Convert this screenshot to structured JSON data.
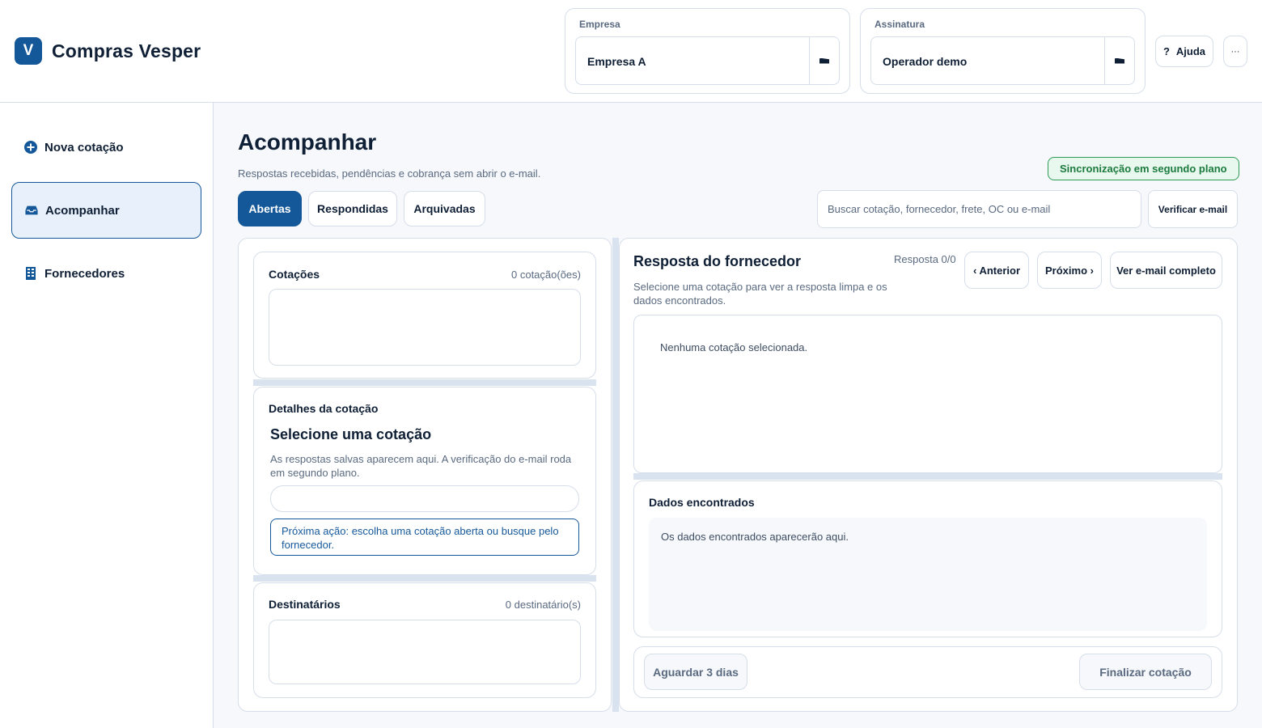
{
  "app": {
    "logo_letter": "V",
    "name": "Compras Vesper",
    "brand_color": "#15589a"
  },
  "header": {
    "company": {
      "label": "Empresa",
      "value": "Empresa A"
    },
    "subscription": {
      "label": "Assinatura",
      "value": "Operador demo"
    },
    "help_icon": "?",
    "help_label": "Ajuda",
    "more_label": "···"
  },
  "sidebar": {
    "items": [
      {
        "label": "Nova cotação",
        "icon": "plus-circle-icon",
        "active": false
      },
      {
        "label": "Acompanhar",
        "icon": "inbox-icon",
        "active": true
      },
      {
        "label": "Fornecedores",
        "icon": "building-icon",
        "active": false
      }
    ]
  },
  "main": {
    "title": "Acompanhar",
    "subtitle": "Respostas recebidas, pendências e cobrança sem abrir o e-mail.",
    "sync_badge": "Sincronização em segundo plano",
    "tabs": [
      {
        "label": "Abertas",
        "active": true
      },
      {
        "label": "Respondidas",
        "active": false
      },
      {
        "label": "Arquivadas",
        "active": false
      }
    ],
    "search_placeholder": "Buscar cotação, fornecedor, frete, OC ou e-mail",
    "verify_label": "Verificar e-mail"
  },
  "quotes": {
    "title": "Cotações",
    "count": "0 cotação(ões)"
  },
  "details": {
    "title": "Detalhes da cotação",
    "heading": "Selecione uma cotação",
    "text": "As respostas salvas aparecem aqui. A verificação do e-mail roda em segundo plano.",
    "next_action": "Próxima ação: escolha uma cotação aberta ou busque pelo fornecedor."
  },
  "recipients": {
    "title": "Destinatários",
    "count": "0 destinatário(s)"
  },
  "response": {
    "title": "Resposta do fornecedor",
    "subtitle": "Selecione uma cotação para ver a resposta limpa e os dados encontrados.",
    "counter": "Resposta 0/0",
    "prev_label": "‹ Anterior",
    "next_label": "Próximo ›",
    "full_email_label": "Ver e-mail completo",
    "empty": "Nenhuma cotação selecionada."
  },
  "found": {
    "title": "Dados encontrados",
    "empty": "Os dados encontrados aparecerão aqui."
  },
  "actions": {
    "wait_label": "Aguardar 3 dias",
    "finalize_label": "Finalizar cotação"
  }
}
